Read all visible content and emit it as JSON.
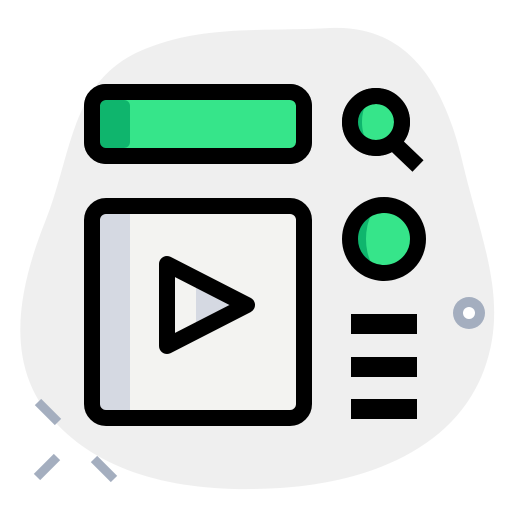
{
  "icon": {
    "name": "video-player-interface-icon"
  },
  "colors": {
    "blob": "#efefef",
    "outline": "#000000",
    "accent_green": "#36e58a",
    "accent_green_dark": "#0fb56d",
    "panel_fill": "#f3f3f1",
    "panel_shade": "#d5d9e2",
    "decor": "#a4aebf"
  },
  "elements": {
    "search_bar": "search-bar",
    "search_button": "search-icon",
    "video_panel": "video-panel",
    "play_button": "play-icon",
    "record_button": "record-button",
    "menu": "menu-lines-icon"
  }
}
